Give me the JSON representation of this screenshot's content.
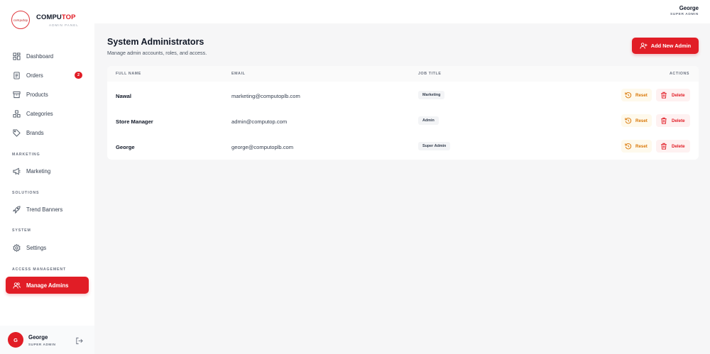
{
  "brand": {
    "logo_text": "computop",
    "name_prefix": "COMPU",
    "name_accent": "TOP",
    "subtitle": "ADMIN PANEL"
  },
  "sidebar": {
    "items": [
      {
        "label": "Dashboard",
        "icon": "dashboard-icon"
      },
      {
        "label": "Orders",
        "icon": "orders-icon",
        "badge": "2"
      },
      {
        "label": "Products",
        "icon": "box-icon"
      },
      {
        "label": "Categories",
        "icon": "categories-icon"
      },
      {
        "label": "Brands",
        "icon": "tag-icon"
      }
    ],
    "sections": {
      "marketing": {
        "title": "MARKETING",
        "item": "Marketing",
        "icon": "megaphone-icon"
      },
      "solutions": {
        "title": "SOLUTIONS",
        "item": "Trend Banners",
        "icon": "rocket-icon"
      },
      "system": {
        "title": "SYSTEM",
        "item": "Settings",
        "icon": "gear-icon"
      },
      "access": {
        "title": "ACCESS MANAGEMENT",
        "item": "Manage Admins",
        "icon": "users-icon"
      }
    },
    "footer_user": {
      "initial": "G",
      "name": "George",
      "role": "SUPER ADMIN"
    }
  },
  "topbar": {
    "name": "George",
    "role": "SUPER ADMIN"
  },
  "main": {
    "title": "System Administrators",
    "subtitle": "Manage admin accounts, roles, and access.",
    "add_button": "Add New Admin",
    "columns": {
      "name": "FULL NAME",
      "email": "EMAIL",
      "job": "JOB TITLE",
      "actions": "ACTIONS"
    },
    "rows": [
      {
        "name": "Nawal",
        "email": "marketing@computoplb.com",
        "job": "Marketing"
      },
      {
        "name": "Store Manager",
        "email": "admin@computop.com",
        "job": "Admin"
      },
      {
        "name": "George",
        "email": "george@computoplb.com",
        "job": "Super Admin"
      }
    ],
    "reset_label": "Reset",
    "delete_label": "Delete"
  },
  "colors": {
    "accent": "#e11d26",
    "warning": "#d97706",
    "background": "#f6f6f7"
  }
}
